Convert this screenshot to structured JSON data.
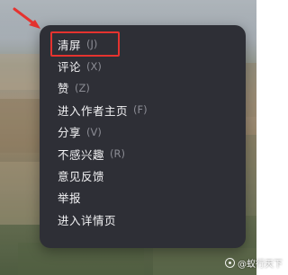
{
  "menu": {
    "items": [
      {
        "label": "清屏",
        "shortcut": "(J)"
      },
      {
        "label": "评论",
        "shortcut": "(X)"
      },
      {
        "label": "赞",
        "shortcut": "(Z)"
      },
      {
        "label": "进入作者主页",
        "shortcut": "(F)"
      },
      {
        "label": "分享",
        "shortcut": "(V)"
      },
      {
        "label": "不感兴趣",
        "shortcut": "(R)"
      },
      {
        "label": "意见反馈",
        "shortcut": ""
      },
      {
        "label": "举报",
        "shortcut": ""
      },
      {
        "label": "进入详情页",
        "shortcut": ""
      }
    ]
  },
  "annotation": {
    "highlighted_item": "清屏",
    "color": "#e5332f"
  },
  "watermark": {
    "text": "@蚁行天下",
    "icon": "watermark-logo-icon"
  },
  "colors": {
    "menu_background": "#2e2f36",
    "menu_text": "#f3f3f5",
    "shortcut_text": "#8b8c94"
  }
}
